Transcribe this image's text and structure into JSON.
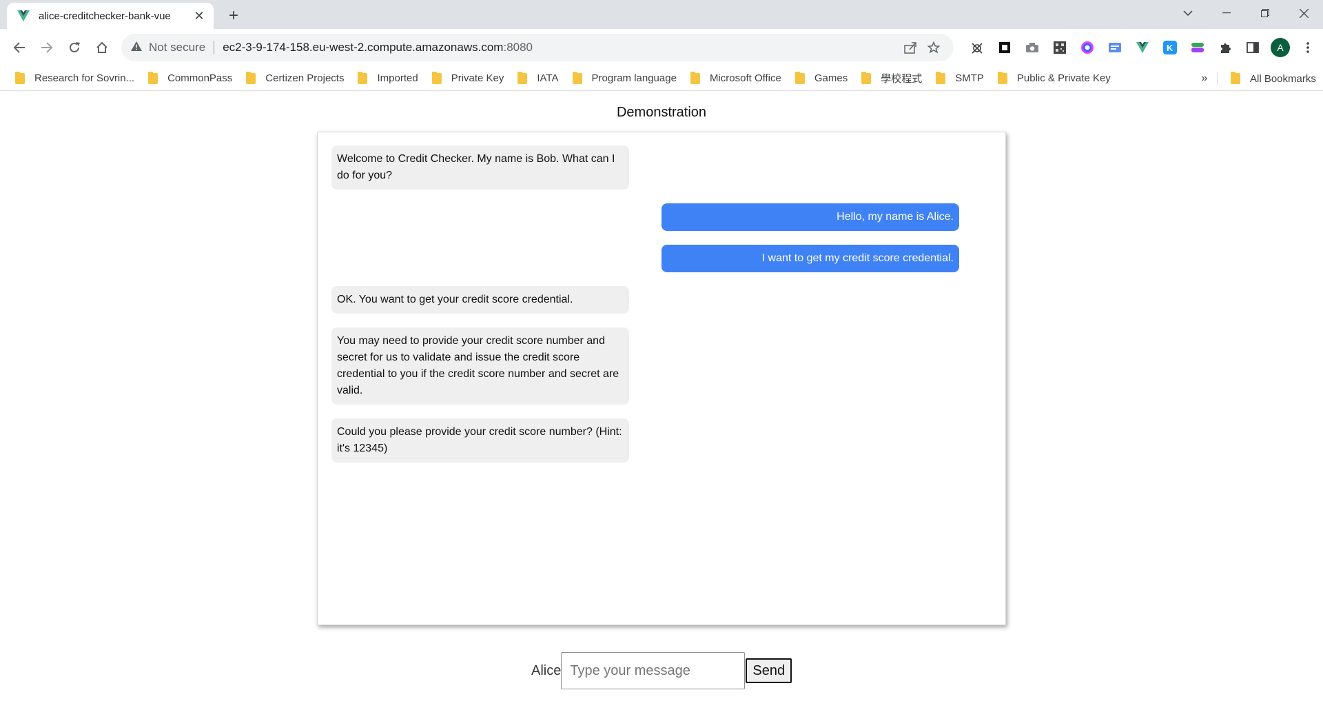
{
  "browser": {
    "tab": {
      "title": "alice-creditchecker-bank-vue",
      "favicon": "vue-logo-icon"
    },
    "security_label": "Not secure",
    "url_host": "ec2-3-9-174-158.eu-west-2.compute.amazonaws.com",
    "url_port": ":8080",
    "avatar_letter": "A",
    "bookmarks": [
      "Research for Sovrin...",
      "CommonPass",
      "Certizen Projects",
      "Imported",
      "Private Key",
      "IATA",
      "Program language",
      "Microsoft Office",
      "Games",
      "學校程式",
      "SMTP",
      "Public & Private Key"
    ],
    "bookmarks_more": "»",
    "all_bookmarks": "All Bookmarks"
  },
  "page": {
    "title": "Demonstration",
    "messages": [
      {
        "from": "bot",
        "text": "Welcome to Credit Checker. My name is Bob. What can I do for you?"
      },
      {
        "from": "user",
        "text": "Hello, my name is Alice."
      },
      {
        "from": "user",
        "text": "I want to get my credit score credential."
      },
      {
        "from": "bot",
        "text": "OK. You want to get your credit score credential."
      },
      {
        "from": "bot",
        "text": "You may need to provide your credit score number and secret for us to validate and issue the credit score credential to you if the credit score number and secret are valid."
      },
      {
        "from": "bot",
        "text": "Could you please provide your credit score number? (Hint: it's 12345)"
      }
    ],
    "composer": {
      "sender": "Alice",
      "placeholder": "Type your message",
      "value": "",
      "send_label": "Send"
    }
  },
  "colors": {
    "user_bubble": "#3f82f6",
    "bot_bubble": "#efefef"
  }
}
